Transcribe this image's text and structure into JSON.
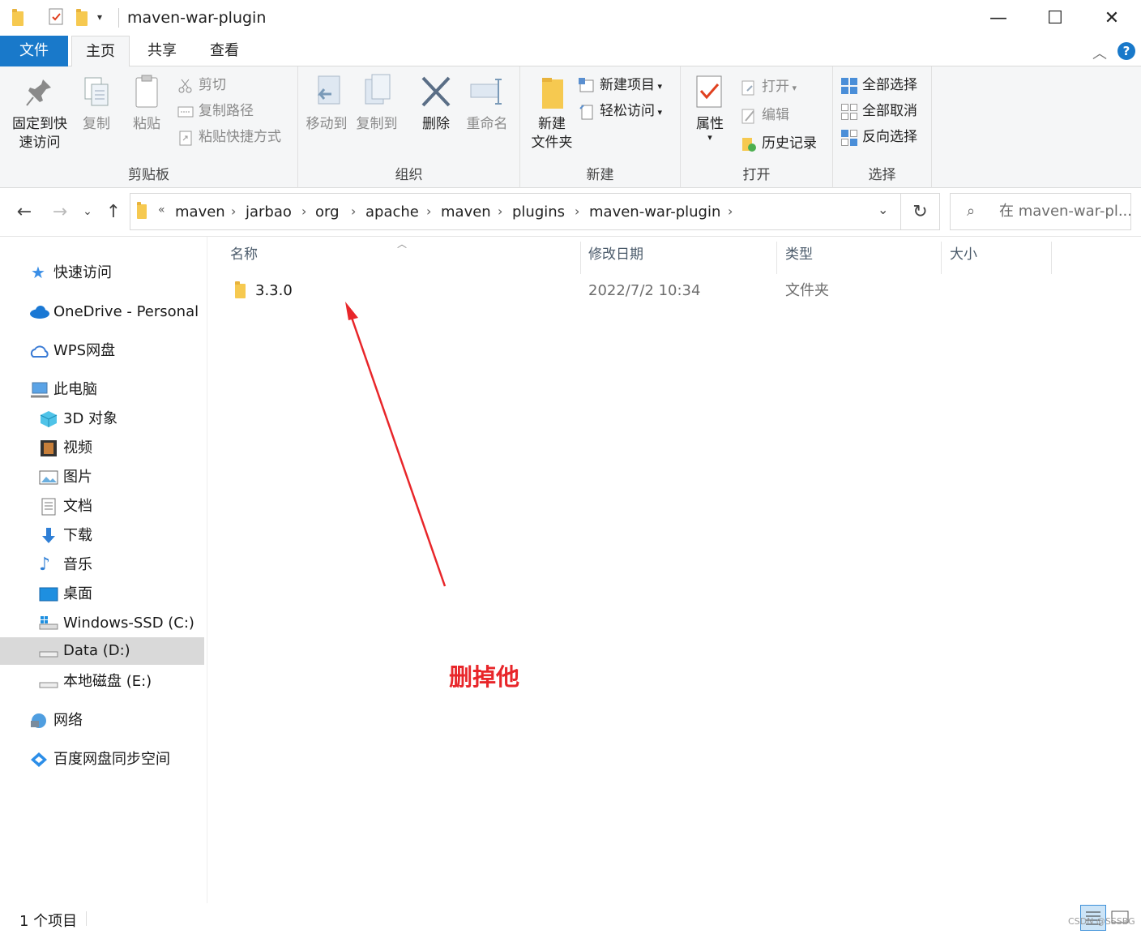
{
  "window": {
    "title": "maven-war-plugin",
    "minimize": "—",
    "maximize": "☐",
    "close": "✕"
  },
  "tabs": [
    {
      "label": "文件"
    },
    {
      "label": "主页"
    },
    {
      "label": "共享"
    },
    {
      "label": "查看"
    }
  ],
  "ribbon": {
    "clipboard": {
      "label": "剪贴板",
      "pin": "固定到快速访问",
      "pin_l1": "固定到快",
      "pin_l2": "速访问",
      "copy": "复制",
      "paste": "粘贴",
      "cut": "剪切",
      "copy_path": "复制路径",
      "paste_shortcut": "粘贴快捷方式"
    },
    "organize": {
      "label": "组织",
      "move_to": "移动到",
      "copy_to": "复制到",
      "delete": "删除",
      "rename": "重命名"
    },
    "new": {
      "label": "新建",
      "new_folder_l1": "新建",
      "new_folder_l2": "文件夹",
      "new_item": "新建项目",
      "easy_access": "轻松访问"
    },
    "open": {
      "label": "打开",
      "properties": "属性",
      "open": "打开",
      "edit": "编辑",
      "history": "历史记录"
    },
    "select": {
      "label": "选择",
      "select_all": "全部选择",
      "select_none": "全部取消",
      "invert": "反向选择"
    }
  },
  "address": {
    "overflow": "«",
    "crumbs": [
      "maven",
      "jarbao",
      "org",
      "apache",
      "maven",
      "plugins",
      "maven-war-plugin"
    ],
    "search_placeholder": "在 maven-war-pl..."
  },
  "nav": {
    "quick_access": "快速访问",
    "onedrive": "OneDrive - Personal",
    "wps": "WPS网盘",
    "this_pc": "此电脑",
    "objects3d": "3D 对象",
    "videos": "视频",
    "pictures": "图片",
    "documents": "文档",
    "downloads": "下载",
    "music": "音乐",
    "desktop": "桌面",
    "drive_c": "Windows-SSD (C:)",
    "drive_d": "Data (D:)",
    "drive_e": "本地磁盘 (E:)",
    "network": "网络",
    "baidu": "百度网盘同步空间"
  },
  "columns": {
    "name": "名称",
    "modified": "修改日期",
    "type": "类型",
    "size": "大小"
  },
  "files": [
    {
      "name": "3.3.0",
      "modified": "2022/7/2 10:34",
      "type": "文件夹",
      "size": ""
    }
  ],
  "annotation": {
    "text": "删掉他",
    "color": "#e8262a"
  },
  "status": {
    "count": "1 个项目"
  },
  "watermark": "CSDN @SSSBG"
}
